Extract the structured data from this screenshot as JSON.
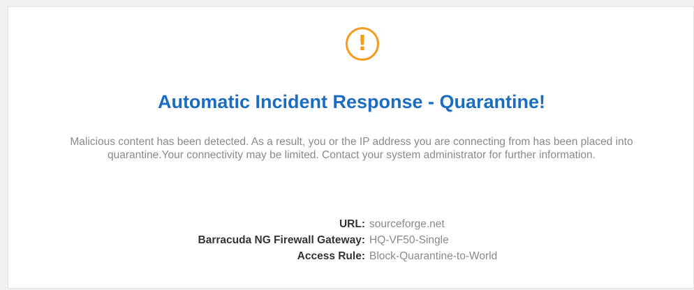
{
  "alert": {
    "icon": "exclamation-circle-icon",
    "icon_glyph": "!",
    "accent_color": "#f39c1f"
  },
  "title": "Automatic Incident Response - Quarantine!",
  "title_color": "#1b6dc1",
  "message": "Malicious content has been detected. As a result, you or the IP address you are connecting from has been placed into quarantine.Your connectivity may be limited. Contact your system administrator for further information.",
  "details": {
    "url_label": "URL:",
    "url_value": "sourceforge.net",
    "gateway_label": "Barracuda NG Firewall Gateway:",
    "gateway_value": "HQ-VF50-Single",
    "rule_label": "Access Rule:",
    "rule_value": "Block-Quarantine-to-World"
  }
}
